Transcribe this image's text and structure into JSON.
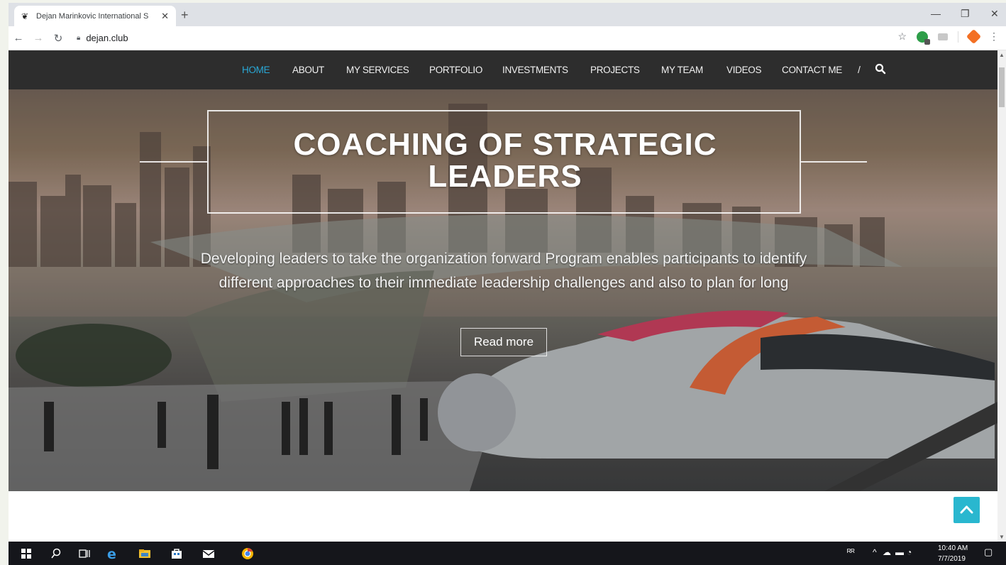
{
  "browser": {
    "tab_title": "Dejan Marinkovic International S",
    "tab_favicon": "eagle-favicon-icon",
    "address": "dejan.club"
  },
  "site": {
    "nav": [
      "HOME",
      "ABOUT",
      "MY SERVICES",
      "PORTFOLIO",
      "INVESTMENTS",
      "PROJECTS",
      "MY TEAM",
      "VIDEOS",
      "CONTACT ME"
    ],
    "active_nav": "HOME",
    "nav_separator": "/",
    "accent_color": "#29a8d6"
  },
  "hero": {
    "title_line1": "COACHING OF STRATEGIC",
    "title_line2": "LEADERS",
    "desc_line1": "Developing leaders to take the organization forward Program enables participants to identify",
    "desc_line2": "different approaches to their immediate leadership challenges and also to plan for long",
    "button": "Read more"
  },
  "taskbar": {
    "time": "10:40 AM",
    "date": "7/7/2019"
  }
}
